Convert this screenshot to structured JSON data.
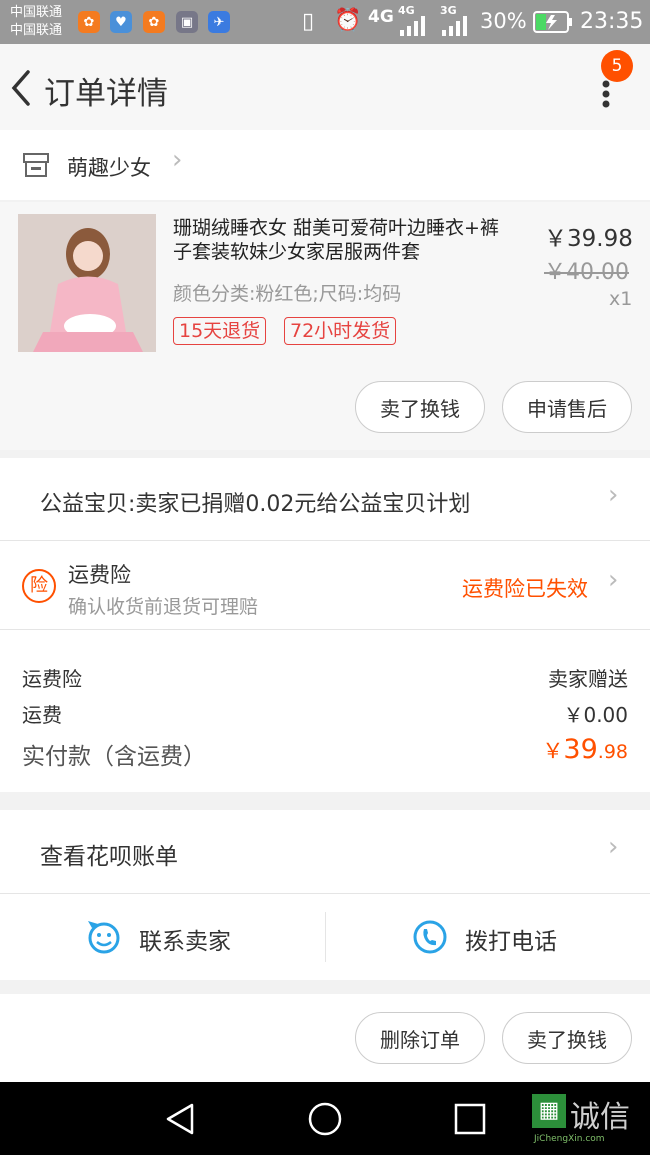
{
  "status_bar": {
    "carrier_1": "中国联通",
    "carrier_2": "中国联通",
    "network_1": "4G",
    "network_2": "4G",
    "network_3": "3G",
    "battery": "30%",
    "time": "23:35"
  },
  "header": {
    "title": "订单详情",
    "badge_count": "5"
  },
  "shop": {
    "name": "萌趣少女"
  },
  "product": {
    "title": "珊瑚绒睡衣女 甜美可爱荷叶边睡衣+裤子套装软妹少女家居服两件套",
    "spec": "颜色分类:粉红色;尺码:均码",
    "price": "￥39.98",
    "original_price": "￥40.00",
    "quantity": "x1",
    "tags": [
      "15天退货",
      "72小时发货"
    ],
    "buttons": [
      "卖了换钱",
      "申请售后"
    ]
  },
  "charity": {
    "text": "公益宝贝:卖家已捐赠0.02元给公益宝贝计划"
  },
  "insurance": {
    "icon_char": "险",
    "title": "运费险",
    "subtitle": "确认收货前退货可理赔",
    "status": "运费险已失效"
  },
  "summary": {
    "rows": [
      {
        "label": "运费险",
        "value": "卖家赠送"
      },
      {
        "label": "运费",
        "value": "￥0.00"
      }
    ],
    "paid_label": "实付款（含运费）",
    "paid_currency": "￥",
    "paid_int": "39",
    "paid_dec": ".98"
  },
  "huabei": {
    "text": "查看花呗账单"
  },
  "contact": {
    "seller": "联系卖家",
    "phone": "拨打电话"
  },
  "bottom": {
    "buttons": [
      "删除订单",
      "卖了换钱"
    ]
  },
  "watermark": {
    "text": "诚信",
    "sub": "JiChengXin.com"
  },
  "colors": {
    "accent_orange": "#ff5000",
    "tag_red": "#e64340",
    "contact_blue": "#2aa3e6"
  }
}
